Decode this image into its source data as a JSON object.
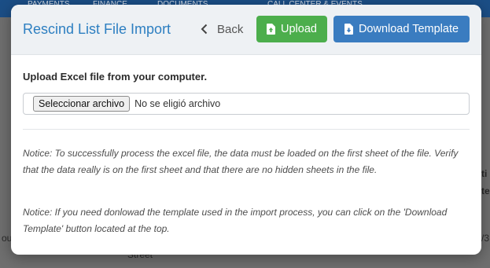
{
  "background": {
    "nav_items": [
      "PAYMENTS",
      "FINANCE",
      "DOCUMENTS",
      "CALL CENTER & EVENTS"
    ],
    "right_fragment_1": "ti",
    "right_fragment_2": "te",
    "left_fragment": "ou",
    "right_fragment_3": "/3",
    "bottom_fragment": "Street"
  },
  "modal": {
    "title": "Rescind List File Import",
    "back_label": "Back",
    "upload_label": "Upload",
    "download_label": "Download Template",
    "upload_instruction": "Upload Excel file from your computer.",
    "file_input": {
      "button_label": "Seleccionar archivo",
      "status_text": "No se eligió archivo"
    },
    "notices": [
      "Notice: To successfully process the excel file, the data must be loaded on the first sheet of the file. Verify that the data really is on the first sheet and that there are no hidden sheets in the file.",
      "Notice: If you need donlowad the template used in the import process, you can click on the 'Download Template' button located at the top."
    ]
  },
  "colors": {
    "title": "#2d7fc1",
    "upload_button": "#4cae4c",
    "download_button": "#3a7cc0",
    "header_bg": "#eef1f4"
  },
  "icons": {
    "back": "chevron-left-icon",
    "upload": "file-upload-icon",
    "download": "file-download-icon"
  }
}
